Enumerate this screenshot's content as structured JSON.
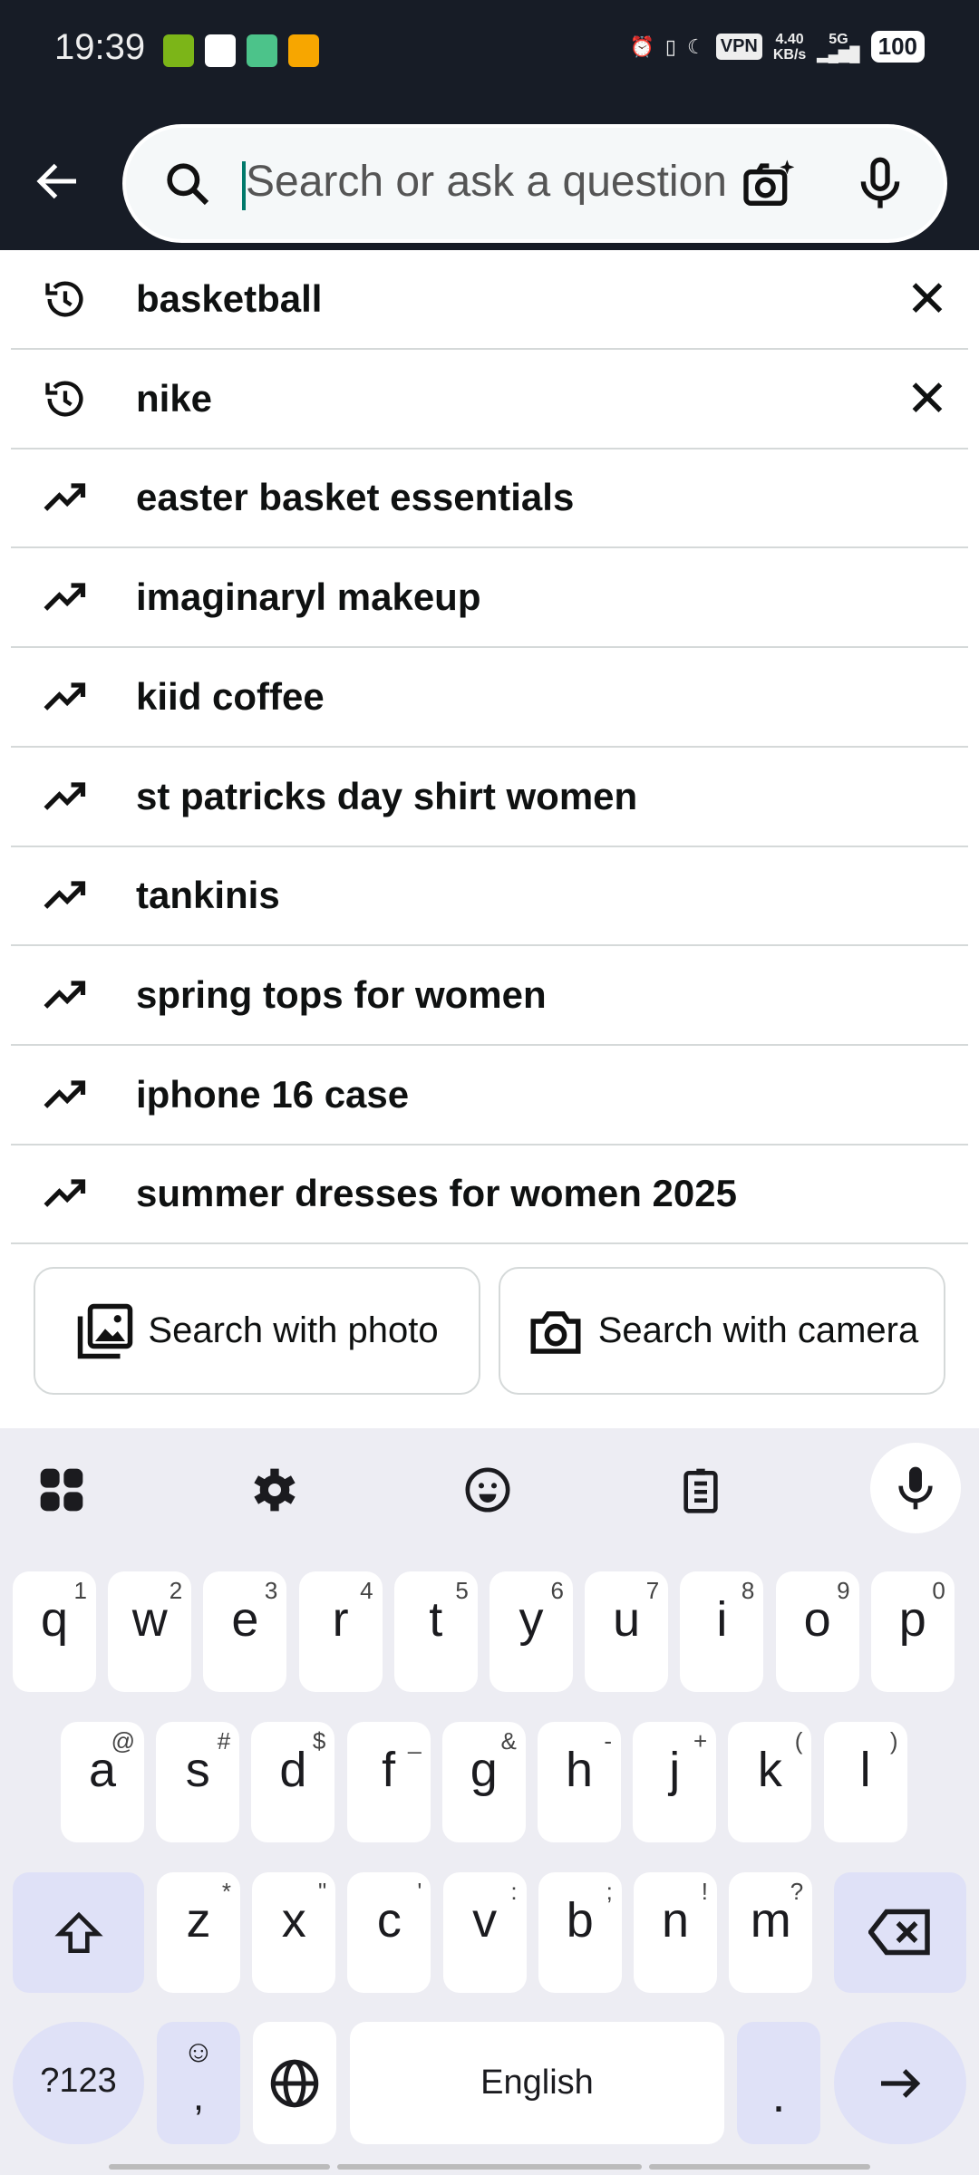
{
  "status": {
    "time": "19:39",
    "speed_value": "4.40",
    "speed_unit": "KB/s",
    "network": "5G",
    "battery": "100",
    "vpn": "VPN",
    "app_icon_colors": [
      "#7cb518",
      "#ffffff",
      "#4cc38a",
      "#f7a600"
    ]
  },
  "search": {
    "placeholder": "Search or ask a question",
    "value": ""
  },
  "suggestions": [
    {
      "text": "basketball",
      "type": "history"
    },
    {
      "text": "nike",
      "type": "history"
    },
    {
      "text": "easter basket essentials",
      "type": "trending"
    },
    {
      "text": "imaginaryl makeup",
      "type": "trending"
    },
    {
      "text": "kiid coffee",
      "type": "trending"
    },
    {
      "text": "st patricks day shirt women",
      "type": "trending"
    },
    {
      "text": "tankinis",
      "type": "trending"
    },
    {
      "text": "spring tops for women",
      "type": "trending"
    },
    {
      "text": "iphone 16 case",
      "type": "trending"
    },
    {
      "text": "summer dresses for women 2025",
      "type": "trending"
    }
  ],
  "buttons": {
    "photo": "Search with photo",
    "camera": "Search with camera"
  },
  "keyboard": {
    "row1": [
      [
        "q",
        "1"
      ],
      [
        "w",
        "2"
      ],
      [
        "e",
        "3"
      ],
      [
        "r",
        "4"
      ],
      [
        "t",
        "5"
      ],
      [
        "y",
        "6"
      ],
      [
        "u",
        "7"
      ],
      [
        "i",
        "8"
      ],
      [
        "o",
        "9"
      ],
      [
        "p",
        "0"
      ]
    ],
    "row2": [
      [
        "a",
        "@"
      ],
      [
        "s",
        "#"
      ],
      [
        "d",
        "$"
      ],
      [
        "f",
        "_"
      ],
      [
        "g",
        "&"
      ],
      [
        "h",
        "-"
      ],
      [
        "j",
        "+"
      ],
      [
        "k",
        "("
      ],
      [
        "l",
        ")"
      ]
    ],
    "row3": [
      [
        "z",
        "*"
      ],
      [
        "x",
        "\""
      ],
      [
        "c",
        "'"
      ],
      [
        "v",
        ":"
      ],
      [
        "b",
        ";"
      ],
      [
        "n",
        "!"
      ],
      [
        "m",
        "?"
      ]
    ],
    "symbols": "?123",
    "comma": ",",
    "space": "English",
    "period": "."
  }
}
